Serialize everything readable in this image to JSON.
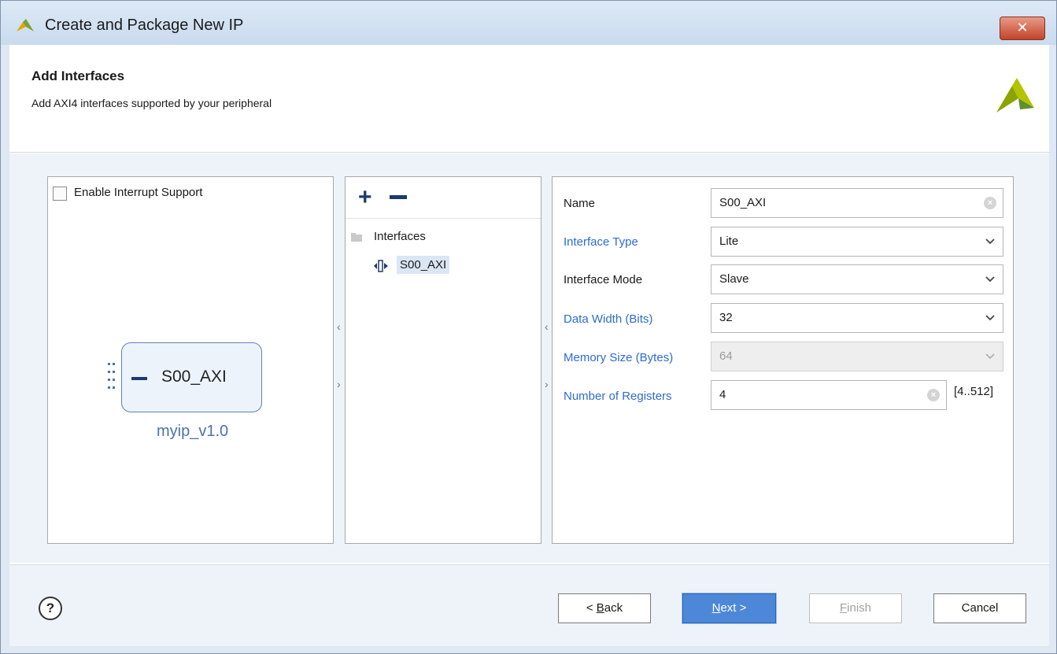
{
  "window": {
    "title": "Create and Package New IP",
    "close_label": "✕"
  },
  "header": {
    "title": "Add Interfaces",
    "subtitle": "Add AXI4 interfaces supported by your peripheral"
  },
  "left_panel": {
    "interrupt_label": "Enable Interrupt Support",
    "interrupt_checked": false,
    "ip_interface_name": "S00_AXI",
    "ip_caption": "myip_v1.0"
  },
  "tree_panel": {
    "add_label": "+",
    "root_label": "Interfaces",
    "items": [
      {
        "label": "S00_AXI",
        "selected": true
      }
    ]
  },
  "properties": {
    "name": {
      "label": "Name",
      "value": "S00_AXI"
    },
    "interface_type": {
      "label": "Interface Type",
      "value": "Lite"
    },
    "interface_mode": {
      "label": "Interface Mode",
      "value": "Slave"
    },
    "data_width": {
      "label": "Data Width (Bits)",
      "value": "32"
    },
    "memory_size": {
      "label": "Memory Size (Bytes)",
      "value": "64"
    },
    "num_registers": {
      "label": "Number of Registers",
      "value": "4",
      "range": "[4..512]"
    }
  },
  "footer": {
    "help_label": "?",
    "back_prefix": "< ",
    "back_key": "B",
    "back_rest": "ack",
    "next_key": "N",
    "next_rest": "ext >",
    "finish_key": "F",
    "finish_rest": "inish",
    "cancel_label": "Cancel"
  },
  "colors": {
    "accent": "#4d88d8",
    "link_label": "#2e6bd1",
    "selection": "#dbe6f4"
  }
}
